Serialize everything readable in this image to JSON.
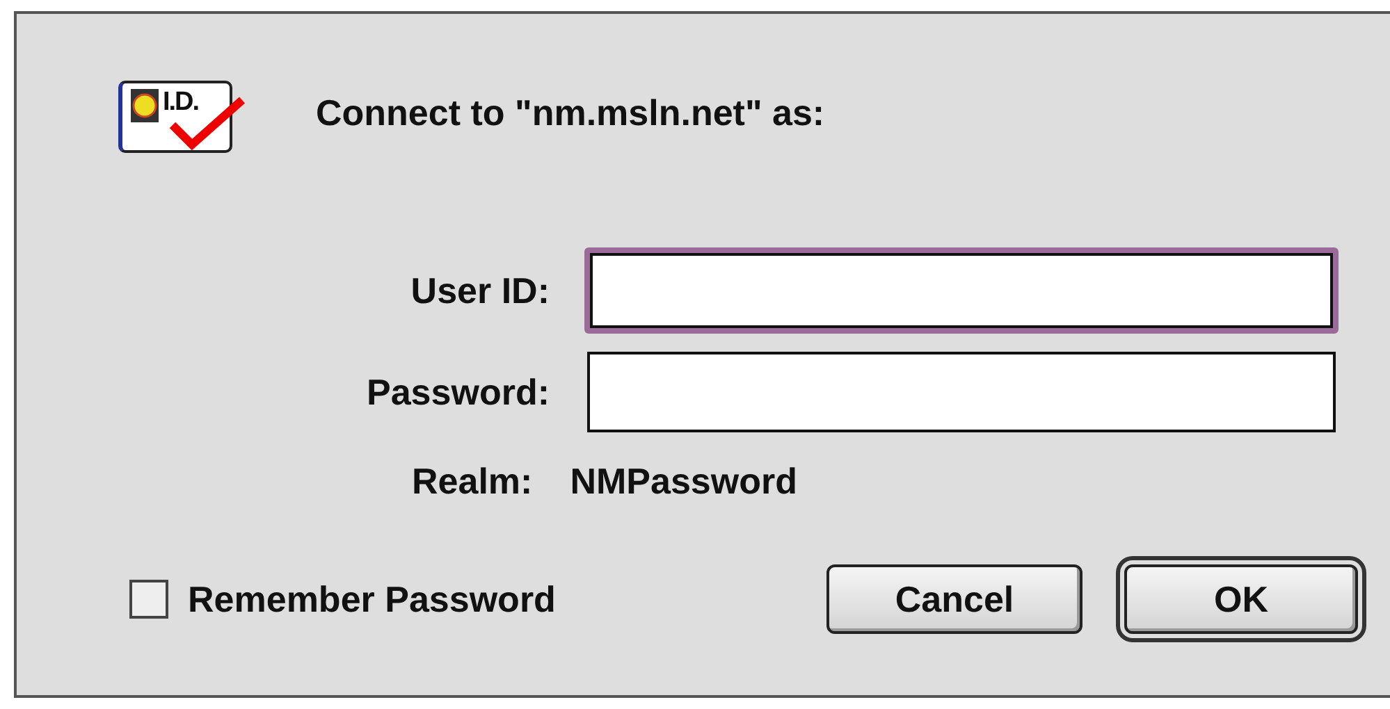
{
  "dialog": {
    "badge_text": "I.D.",
    "title": "Connect to \"nm.msln.net\" as:"
  },
  "fields": [
    {
      "label": "User ID:",
      "focused": true
    },
    {
      "label": "Password:",
      "focused": false
    }
  ],
  "realm": {
    "label": "Realm:",
    "value": "NMPassword"
  },
  "remember": {
    "label": "Remember Password",
    "checked": false
  },
  "buttons": [
    {
      "label": "Cancel",
      "default": false
    },
    {
      "label": "OK",
      "default": true
    }
  ]
}
